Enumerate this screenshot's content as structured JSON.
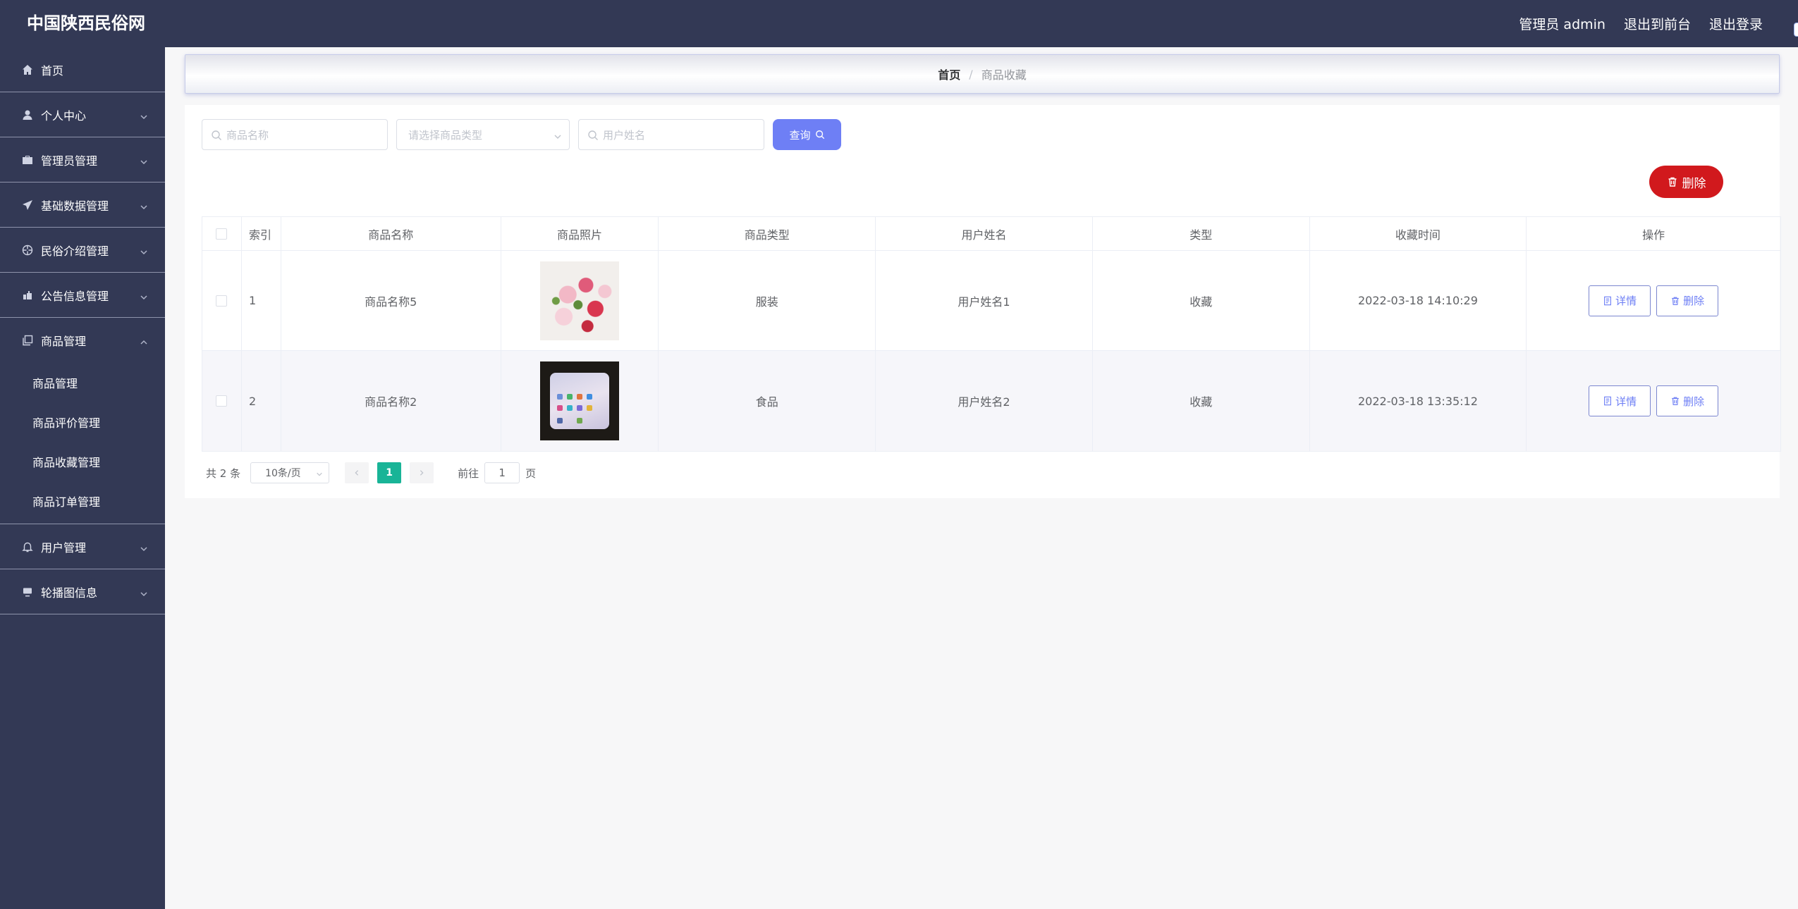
{
  "header": {
    "brand": "中国陕西民俗网",
    "admin_label": "管理员 admin",
    "to_front_label": "退出到前台",
    "logout_label": "退出登录"
  },
  "sidebar": {
    "items": [
      {
        "label": "首页",
        "icon": "home-icon"
      },
      {
        "label": "个人中心",
        "icon": "user-icon"
      },
      {
        "label": "管理员管理",
        "icon": "briefcase-icon"
      },
      {
        "label": "基础数据管理",
        "icon": "send-icon"
      },
      {
        "label": "民俗介绍管理",
        "icon": "aperture-icon"
      },
      {
        "label": "公告信息管理",
        "icon": "speaker-icon"
      },
      {
        "label": "商品管理",
        "icon": "copy-icon"
      },
      {
        "label": "用户管理",
        "icon": "bell-icon"
      },
      {
        "label": "轮播图信息",
        "icon": "monitor-icon"
      }
    ],
    "submenu": [
      "商品管理",
      "商品评价管理",
      "商品收藏管理",
      "商品订单管理"
    ]
  },
  "breadcrumb": {
    "home": "首页",
    "separator": "/",
    "current": "商品收藏"
  },
  "search": {
    "name_placeholder": "商品名称",
    "type_placeholder": "请选择商品类型",
    "user_placeholder": "用户姓名",
    "query_label": "查询"
  },
  "delete_label": "删除",
  "table": {
    "headers": [
      "索引",
      "商品名称",
      "商品照片",
      "商品类型",
      "用户姓名",
      "类型",
      "收藏时间",
      "操作"
    ],
    "rows": [
      {
        "index": "1",
        "name": "商品名称5",
        "photo": "flowers",
        "type": "服装",
        "user": "用户姓名1",
        "kind": "收藏",
        "time": "2022-03-18 14:10:29"
      },
      {
        "index": "2",
        "name": "商品名称2",
        "photo": "phone",
        "type": "食品",
        "user": "用户姓名2",
        "kind": "收藏",
        "time": "2022-03-18 13:35:12"
      }
    ],
    "detail_label": "详情",
    "row_delete_label": "删除"
  },
  "pager": {
    "total": "共 2 条",
    "page_size": "10条/页",
    "current_page": "1",
    "goto_prefix": "前往",
    "goto_value": "1",
    "goto_suffix": "页"
  },
  "colors": {
    "header_bg": "#333955",
    "accent": "#6e7ff5",
    "danger": "#d1191d",
    "pager_active": "#19b497"
  }
}
